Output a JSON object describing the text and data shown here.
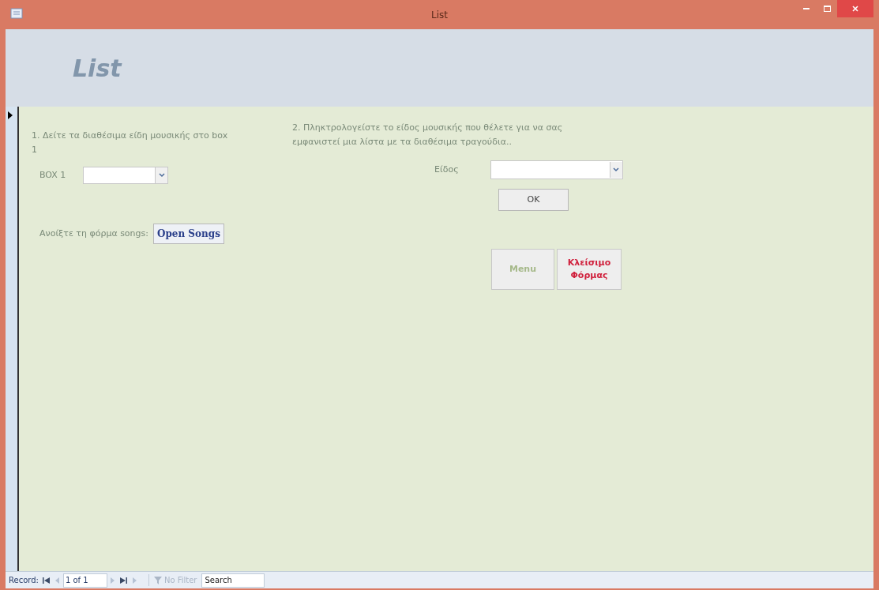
{
  "window": {
    "title": "List"
  },
  "header": {
    "title": "List"
  },
  "left": {
    "instruction": "1. Δείτε τα διαθέσιμα είδη μουσικής στο box 1",
    "box_label": "BOX 1",
    "open_label": "Ανοίξτε τη φόρμα songs:",
    "open_button": "Open Songs"
  },
  "right": {
    "instruction": "2. Πληκτρολογείστε το είδος μουσικής που θέλετε για να σας εμφανιστεί μια λίστα με τα διαθέσιμα τραγούδια..",
    "genre_label": "Είδος",
    "ok_button": "OK"
  },
  "buttons": [
    {
      "label": "Menu",
      "kind": "menu"
    },
    {
      "label": "Κλείσιμο Φόρμας",
      "kind": "close"
    }
  ],
  "status_bar": {
    "record_label": "Record:",
    "record_value": "1 of 1",
    "filter": {
      "label": "No Filter",
      "disabled": true
    },
    "search": {
      "placeholder": "Search"
    }
  }
}
